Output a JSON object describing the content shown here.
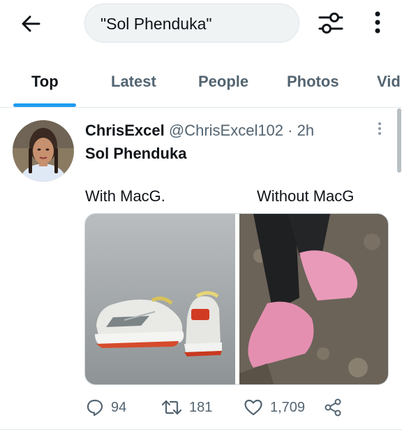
{
  "search": {
    "query": "\"Sol Phenduka\""
  },
  "icons": {
    "back": "arrow-left-icon",
    "filter": "sliders-icon",
    "more": "more-vertical-icon",
    "reply": "reply-icon",
    "retweet": "retweet-icon",
    "like": "heart-icon",
    "share": "share-icon"
  },
  "tabs": [
    {
      "label": "Top",
      "active": true
    },
    {
      "label": "Latest",
      "active": false
    },
    {
      "label": "People",
      "active": false
    },
    {
      "label": "Photos",
      "active": false
    },
    {
      "label": "Vid",
      "active": false
    }
  ],
  "tweet": {
    "display_name": "ChrisExcel",
    "handle": "@ChrisExcel102",
    "separator": "·",
    "time": "2h",
    "text": "Sol Phenduka",
    "caption_left": "With MacG.",
    "caption_right": "Without MacG",
    "replies": "94",
    "retweets": "181",
    "likes": "1,709"
  },
  "colors": {
    "accent": "#1d9bf0",
    "text_primary": "#0f1419",
    "text_secondary": "#536471",
    "search_bg": "#eff3f4"
  }
}
